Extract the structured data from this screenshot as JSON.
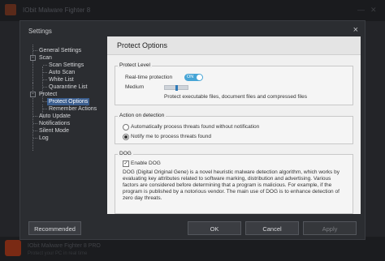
{
  "background": {
    "title": "IObit Malware Fighter 8",
    "bottom_title": "IObit Malware Fighter 8 PRO",
    "bottom_sub": "Protect your PC in real time"
  },
  "dialog": {
    "title": "Settings",
    "close_glyph": "×"
  },
  "tree": {
    "items": [
      {
        "label": "General Settings"
      },
      {
        "label": "Scan"
      },
      {
        "label": "Scan Settings"
      },
      {
        "label": "Auto Scan"
      },
      {
        "label": "White List"
      },
      {
        "label": "Quarantine List"
      },
      {
        "label": "Protect"
      },
      {
        "label": "Protect Options"
      },
      {
        "label": "Remember Actions"
      },
      {
        "label": "Auto Update"
      },
      {
        "label": "Notifications"
      },
      {
        "label": "Silent Mode"
      },
      {
        "label": "Log"
      }
    ],
    "collapse_glyph": "−"
  },
  "panel": {
    "title": "Protect Options",
    "protect_level": {
      "label": "Protect Level",
      "realtime_label": "Real-time protection",
      "toggle_label": "ON",
      "level_label": "Medium",
      "level_fraction": 0.5,
      "desc": "Protect executable files, document files and compressed files"
    },
    "action": {
      "label": "Action on detection",
      "option1": "Automatically process threats found without notification",
      "option2": "Notify me to process threats found",
      "selected": 2
    },
    "dog": {
      "label": "DOG",
      "enable_label": "Enable DOG",
      "check_glyph": "✓",
      "desc": "DOG (Digital Original Gene) is a novel heuristic malware detection algorithm, which works by evaluating key attributes related to software marking, distribution and advertising. Various factors are considered before determining that a program is malicious. For example, if the program is published by a notorious vendor. The main use of DOG is to enhance detection of zero day threats."
    }
  },
  "buttons": {
    "recommended": "Recommended",
    "ok": "OK",
    "cancel": "Cancel",
    "apply": "Apply"
  }
}
